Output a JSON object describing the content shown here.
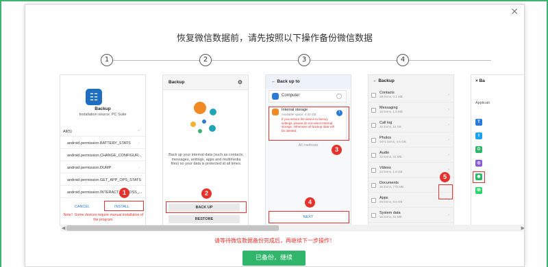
{
  "dialog": {
    "title": "恢复微信数据前，请先按照以下操作备份微信数据",
    "close": "×",
    "notice": "请等待微信数据备份完成后，再继续下一步操作！",
    "continue_button": "已备份，继续"
  },
  "steps": [
    "1",
    "2",
    "3",
    "4"
  ],
  "badges": [
    "1",
    "2",
    "3",
    "4",
    "5"
  ],
  "phone1": {
    "title": "Backup",
    "subtitle": "Installation source: PC Suite",
    "section": "All(5)",
    "permissions": [
      "android.permission.BATTERY_STATS",
      "android.permission.CHANGE_CONFIGUR...",
      "android.permission.DUMP",
      "android.permission.GET_APP_OPS_STATS",
      "android.permission.INTERACT_ACROSS_..."
    ],
    "cancel": "CANCEL",
    "install": "INSTALL",
    "note": "Note！Some devices require manual installation of the program."
  },
  "phone2": {
    "title": "Backup",
    "description": "Back up your internal data (such as contacts, messages, settings, apps and multimedia files) so your data is protected at all times.",
    "backup": "BACK UP",
    "restore": "RESTORE"
  },
  "phone3": {
    "title": "Back up to",
    "computer": "Computer",
    "internal": "Internal storage",
    "available": "Available space: 4.32 GB",
    "warning": "If you restore the device to factory settings, please do not select Internal storage. Otherwise all backup data will be deleted.",
    "all_methods": "All methods",
    "next": "NEXT"
  },
  "phone4": {
    "title": "Backup",
    "items": [
      {
        "name": "Contacts",
        "meta": "29 items, 0.1 MB"
      },
      {
        "name": "Messaging",
        "meta": "16 items, 1.5 MB"
      },
      {
        "name": "Call log",
        "meta": "46 items, 16 KB"
      },
      {
        "name": "Photos",
        "meta": "4871 items, 4.6 GB"
      },
      {
        "name": "Audio",
        "meta": "12 items, 31 MB"
      },
      {
        "name": "Videos",
        "meta": "24 items, 1.6 GB"
      },
      {
        "name": "Documents",
        "meta": "36 items, 775 MB"
      },
      {
        "name": "Apps",
        "meta": "29 items, 8.5 GB"
      },
      {
        "name": "System data",
        "meta": "16 items, 15 MB"
      }
    ]
  },
  "phone5": {
    "title": "Ba",
    "section": "Applicati"
  },
  "colors": {
    "accent_green": "#2fb66a",
    "alert_red": "#e5322d",
    "border_green": "#3cb371"
  }
}
